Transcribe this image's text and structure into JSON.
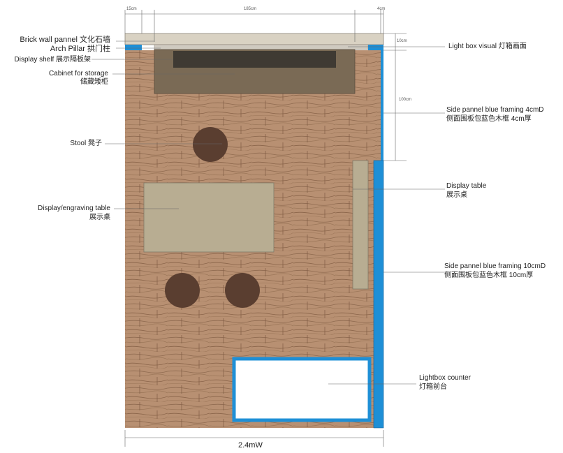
{
  "dimensions": {
    "pillar_width": "15cm",
    "inner_width": "185cm",
    "right_frame": "4cm",
    "lightbox_depth": "10cm",
    "side_height": "100cm",
    "total_width": "2.4mW"
  },
  "labels": {
    "brick_wall": "Brick wall pannel 文化石墙",
    "arch_pillar": "Arch Pillar 拱门柱",
    "display_shelf": "Display shelf 展示隔板架",
    "cabinet_en": "Cabinet for storage",
    "cabinet_cn": "储藏矮柜",
    "stool": "Stool 凳子",
    "engraving_en": "Display/engraving table",
    "engraving_cn": "展示桌",
    "lightbox_visual": "Light box visual 灯箱画面",
    "side4_en": "Side pannel blue framing 4cmD",
    "side4_cn": "侧面围板包蓝色木框 4cm厚",
    "display_table_en": "Display table",
    "display_table_cn": "展示桌",
    "side10_en": "Side pannel blue framing 10cmD",
    "side10_cn": "侧面围板包蓝色木框 10cm厚",
    "counter_en": "Lightbox counter",
    "counter_cn": "灯箱前台"
  },
  "colors": {
    "blue_frame": "#1e8fd6",
    "wall": "#d9d2c3",
    "cabinet": "#7a6a55",
    "table": "#b8ad92",
    "stool": "#5a3e30",
    "wood": "#b89072"
  }
}
